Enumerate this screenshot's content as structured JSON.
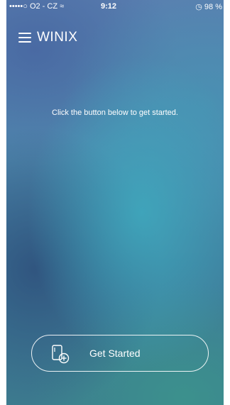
{
  "status_bar": {
    "carrier": "•••••○ O2 - CZ ",
    "time": "9:12",
    "battery_text": "98 %"
  },
  "header": {
    "title": "WINIX"
  },
  "main": {
    "message": "Click the button below to get started."
  },
  "cta": {
    "label": "Get Started",
    "icon": "add-device-icon"
  },
  "colors": {
    "text": "#ffffff",
    "background_top": "#5a7fb0",
    "background_bottom": "#3d7c8f"
  }
}
